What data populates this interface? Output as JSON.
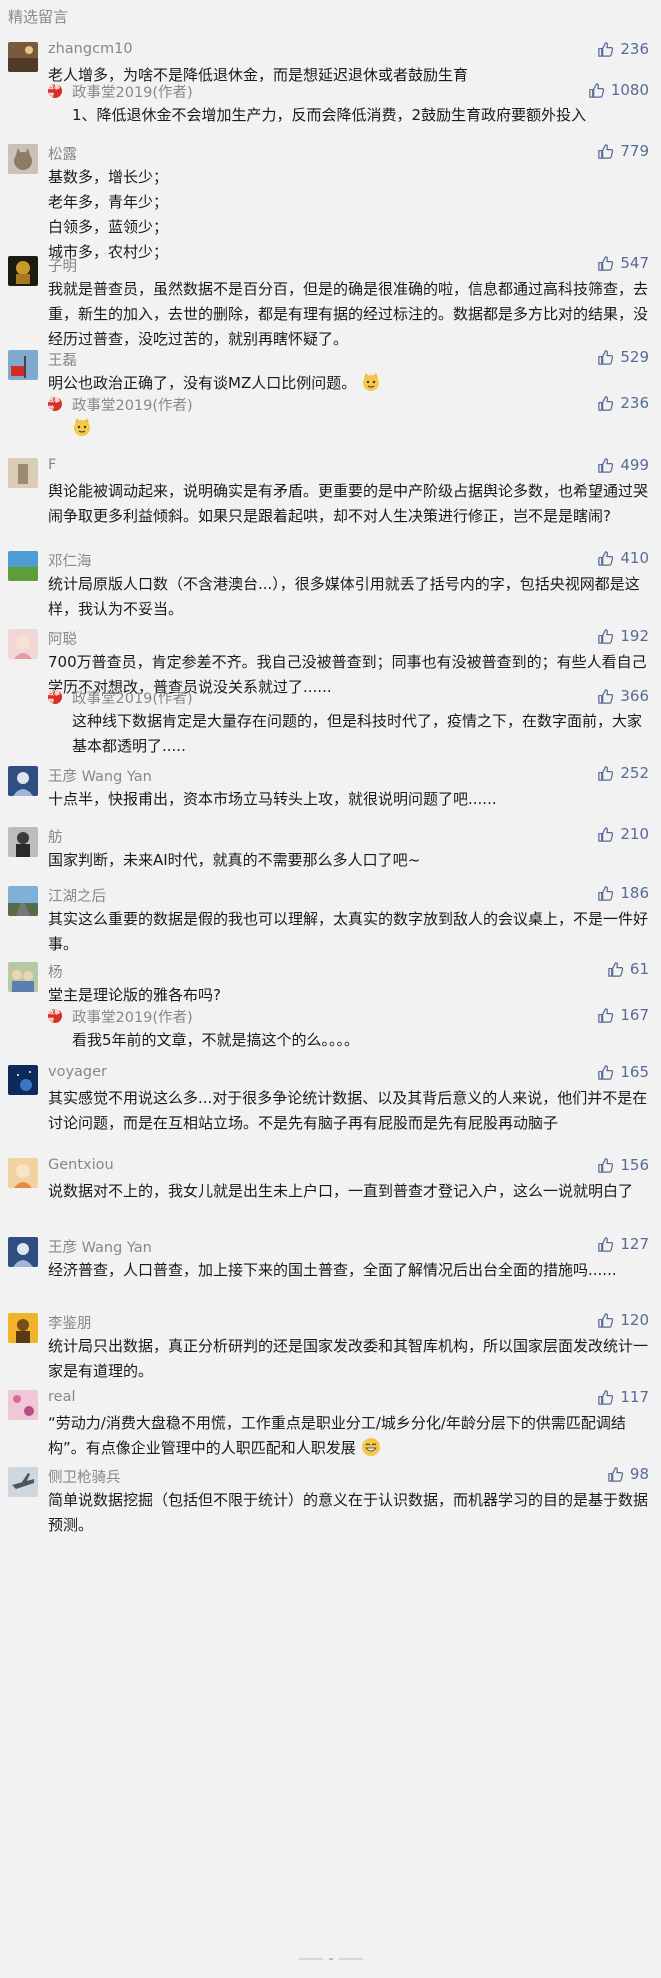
{
  "section": {
    "title": "精选留言"
  },
  "colors": {
    "accent": "#576b95",
    "badge": "#d93025",
    "muted": "#888888"
  },
  "comments": [
    {
      "name": "zhangcm10",
      "likes": "236",
      "avatar": "avatar-landscape-brown",
      "text": "老人增多，为啥不是降低退休金，而是想延迟退休或者鼓励生育",
      "reply": {
        "badge": "政事堂",
        "author": "政事堂2019(作者)",
        "likes": "1080",
        "text": "1、降低退休金不会增加生产力，反而会降低消费，2鼓励生育政府要额外投入"
      }
    },
    {
      "name": "松露",
      "likes": "779",
      "avatar": "avatar-cat",
      "text": "基数多，增长少；\n老年多，青年少；\n白领多，蓝领少；\n城市多，农村少；"
    },
    {
      "name": "子明",
      "likes": "547",
      "avatar": "avatar-gold-figure",
      "text": "我就是普查员，虽然数据不是百分百，但是的确是很准确的啦，信息都通过高科技筛查，去重，新生的加入，去世的删除，都是有理有据的经过标注的。数据都是多方比对的结果，没经历过普查，没吃过苦的，就别再瞎怀疑了。"
    },
    {
      "name": "王磊",
      "likes": "529",
      "avatar": "avatar-red-flag",
      "text": "明公也政治正确了，没有谈MZ人口比例问题。",
      "text_emoji": "cat-face-emoji",
      "reply": {
        "badge": "政事堂",
        "author": "政事堂2019(作者)",
        "likes": "236",
        "text": "",
        "text_emoji": "cat-face-emoji"
      }
    },
    {
      "name": "F",
      "likes": "499",
      "avatar": "avatar-photo-beige",
      "text": "舆论能被调动起来，说明确实是有矛盾。更重要的是中产阶级占据舆论多数，也希望通过哭闹争取更多利益倾斜。如果只是跟着起哄，却不对人生决策进行修正，岂不是是瞎闹?"
    },
    {
      "name": "邓仁海",
      "likes": "410",
      "avatar": "avatar-green-field",
      "text": "统计局原版人口数（不含港澳台...），很多媒体引用就丢了括号内的字，包括央视网都是这样，我认为不妥当。"
    },
    {
      "name": "阿聪",
      "likes": "192",
      "avatar": "avatar-girl-pink",
      "text": "700万普查员，肯定参差不齐。我自己没被普查到；同事也有没被普查到的；有些人看自己学历不对想改，普查员说没关系就过了......",
      "reply": {
        "badge": "政事堂",
        "author": "政事堂2019(作者)",
        "likes": "366",
        "text": "这种线下数据肯定是大量存在问题的，但是科技时代了，疫情之下，在数字面前，大家基本都透明了....."
      }
    },
    {
      "name": "王彦 Wang Yan",
      "likes": "252",
      "avatar": "avatar-blue-portrait",
      "text": "十点半，快报甫出，资本市场立马转头上攻，就很说明问题了吧......"
    },
    {
      "name": "舫",
      "likes": "210",
      "avatar": "avatar-person-dark",
      "text": "国家判断，未来AI时代，就真的不需要那么多人口了吧~"
    },
    {
      "name": "江湖之后",
      "likes": "186",
      "avatar": "avatar-road",
      "text": "其实这么重要的数据是假的我也可以理解，太真实的数字放到敌人的会议桌上，不是一件好事。"
    },
    {
      "name": "杨",
      "likes": "61",
      "avatar": "avatar-kids",
      "text": "堂主是理论版的雅各布吗?",
      "reply": {
        "badge": "政事堂",
        "author": "政事堂2019(作者)",
        "likes": "167",
        "text": "看我5年前的文章，不就是搞这个的么。。。。"
      }
    },
    {
      "name": "voyager",
      "likes": "165",
      "avatar": "avatar-space",
      "text": "其实感觉不用说这么多...对于很多争论统计数据、以及其背后意义的人来说，他们并不是在讨论问题，而是在互相站立场。不是先有脑子再有屁股而是先有屁股再动脑子"
    },
    {
      "name": "Gentxiou",
      "likes": "156",
      "avatar": "avatar-girl-orange",
      "text": "说数据对不上的，我女儿就是出生未上户口，一直到普查才登记入户，这么一说就明白了"
    },
    {
      "name": "王彦 Wang Yan",
      "likes": "127",
      "avatar": "avatar-blue-portrait",
      "text": "经济普查，人口普查，加上接下来的国土普查，全面了解情况后出台全面的措施吗......"
    },
    {
      "name": "李鉴朋",
      "likes": "120",
      "avatar": "avatar-gold-man",
      "text": "统计局只出数据，真正分析研判的还是国家发改委和其智库机构，所以国家层面发改统计一家是有道理的。"
    },
    {
      "name": "real",
      "likes": "117",
      "avatar": "avatar-pink-pattern",
      "text": "“劳动力/消费大盘稳不用慌，工作重点是职业分工/城乡分化/年龄分层下的供需匹配调结构”。有点像企业管理中的人职匹配和人职发展",
      "text_emoji": "grin-emoji"
    },
    {
      "name": "侧卫枪骑兵",
      "likes": "98",
      "avatar": "avatar-jet",
      "text": "简单说数据挖掘（包括但不限于统计）的意义在于认识数据，而机器学习的目的是基于数据预测。"
    }
  ]
}
